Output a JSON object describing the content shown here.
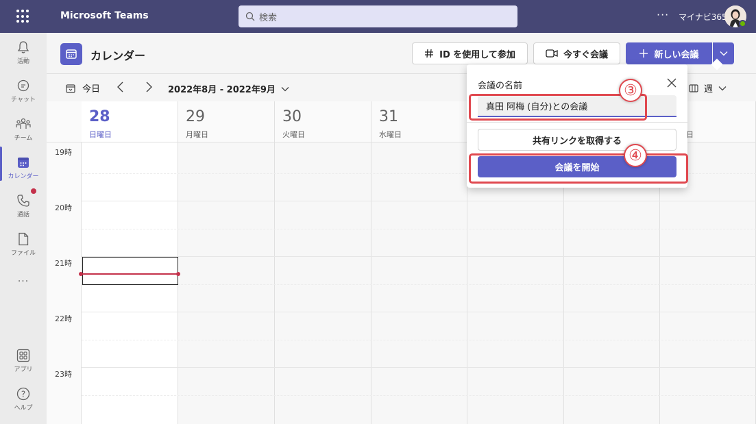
{
  "app": {
    "title": "Microsoft Teams",
    "org": "マイナビ365",
    "more": "···"
  },
  "search": {
    "placeholder": "検索"
  },
  "rail": [
    {
      "label": "活動",
      "icon": "bell-icon"
    },
    {
      "label": "チャット",
      "icon": "chat-icon"
    },
    {
      "label": "チーム",
      "icon": "teams-icon"
    },
    {
      "label": "カレンダー",
      "icon": "calendar-icon",
      "active": true
    },
    {
      "label": "通話",
      "icon": "phone-icon"
    },
    {
      "label": "ファイル",
      "icon": "file-icon"
    },
    {
      "label": "···",
      "icon": "more-icon"
    },
    {
      "label": "アプリ",
      "icon": "apps-icon"
    },
    {
      "label": "ヘルプ",
      "icon": "help-icon"
    }
  ],
  "header": {
    "title": "カレンダー",
    "join_label": "ID を使用して参加",
    "meet_now_label": "今すぐ会議",
    "new_meeting_label": "新しい会議"
  },
  "toolbar": {
    "today_label": "今日",
    "date_range": "2022年8月 - 2022年9月",
    "view_label": "週"
  },
  "days": [
    {
      "num": "28",
      "name": "日曜日",
      "today": true
    },
    {
      "num": "29",
      "name": "月曜日"
    },
    {
      "num": "30",
      "name": "火曜日"
    },
    {
      "num": "31",
      "name": "水曜日"
    },
    {
      "num": "",
      "name": ""
    },
    {
      "num": "",
      "name": ""
    },
    {
      "num": "",
      "name": "日"
    }
  ],
  "hours": [
    "19時",
    "20時",
    "21時",
    "22時",
    "23時"
  ],
  "popup": {
    "label": "会議の名前",
    "input_value": "真田 阿梅 (自分)との会議",
    "share_link_label": "共有リンクを取得する",
    "start_label": "会議を開始"
  },
  "annotations": {
    "step3": "③",
    "step4": "④"
  },
  "colors": {
    "brand": "#5b5fc7",
    "topbar": "#464775",
    "annotation": "#e0484f",
    "now_line": "#c4314b"
  }
}
